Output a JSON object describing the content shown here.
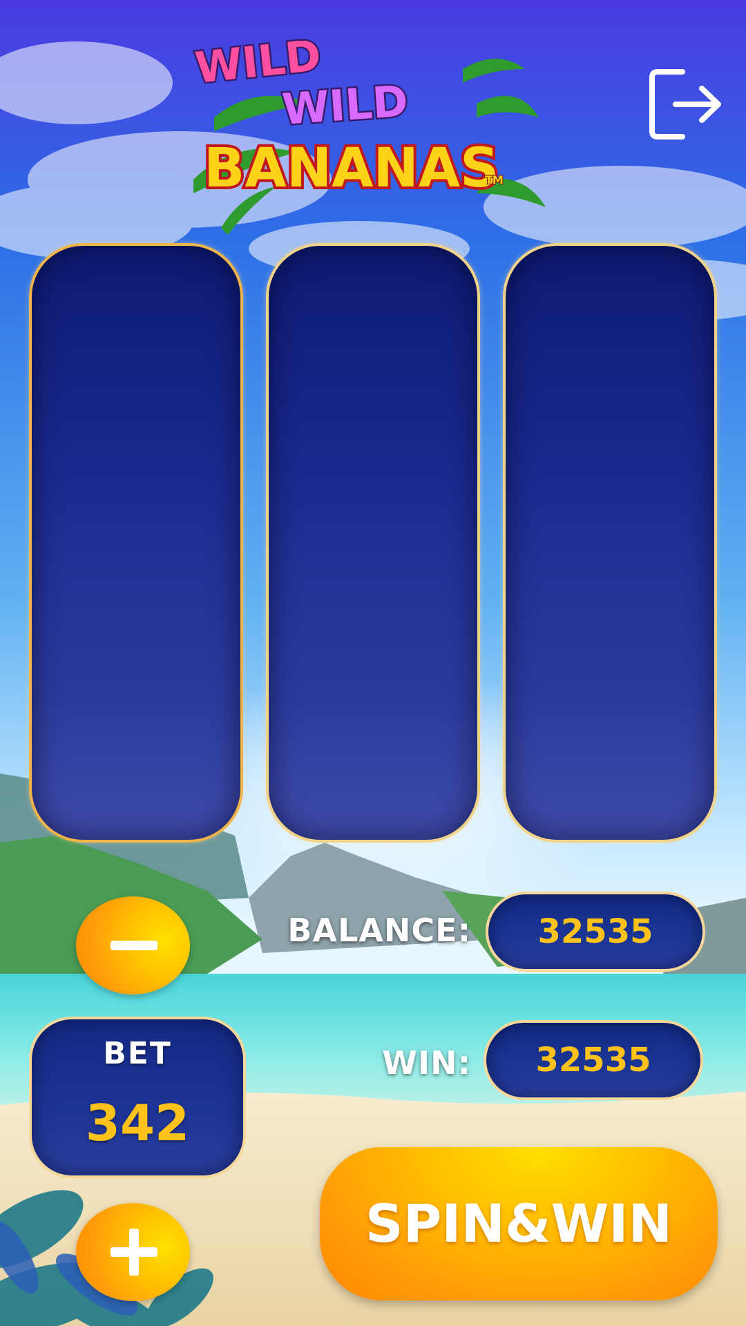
{
  "game": {
    "logo": {
      "line1": "WILD",
      "line2": "WILD",
      "line3": "BANANAS",
      "trademark": "TM"
    }
  },
  "header": {
    "exit_icon": "exit-icon"
  },
  "reels": [
    {
      "id": 1,
      "highlight_color": "#efb44a"
    },
    {
      "id": 2,
      "highlight_color": "#f2d38a"
    },
    {
      "id": 3,
      "highlight_color": "#f2d38a"
    }
  ],
  "controls": {
    "minus_icon": "minus-icon",
    "plus_icon": "plus-icon",
    "bet_label": "BET",
    "bet_value": "342",
    "balance_label": "BALANCE:",
    "balance_value": "32535",
    "win_label": "WIN:",
    "win_value": "32535",
    "spin_label": "SPIN&WIN"
  },
  "colors": {
    "accent_orange": "#ff9d0a",
    "accent_yellow": "#ffc21a",
    "panel_blue": "#1a3593",
    "border_gold": "#f6d79a"
  }
}
